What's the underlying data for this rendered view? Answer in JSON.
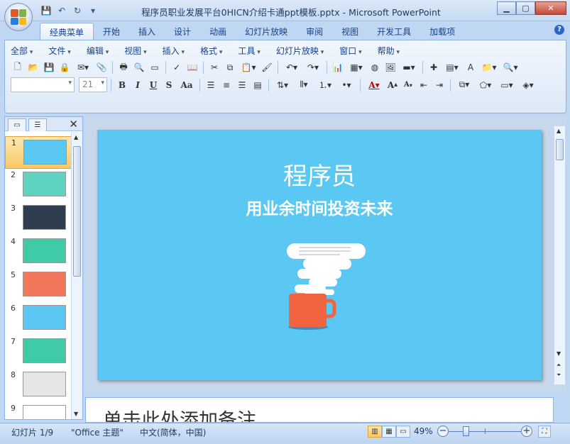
{
  "window": {
    "title": "程序员职业发展平台0HICN介绍卡通ppt模板.pptx - Microsoft PowerPoint",
    "controls": [
      "minimize",
      "maximize",
      "close"
    ]
  },
  "quick_access": [
    {
      "icon": "save-icon"
    },
    {
      "icon": "undo-icon"
    },
    {
      "icon": "redo-icon"
    },
    {
      "icon": "customize-qat-icon"
    }
  ],
  "tabs": [
    {
      "label": "经典菜单",
      "active": true
    },
    {
      "label": "开始"
    },
    {
      "label": "插入"
    },
    {
      "label": "设计"
    },
    {
      "label": "动画"
    },
    {
      "label": "幻灯片放映"
    },
    {
      "label": "审阅"
    },
    {
      "label": "视图"
    },
    {
      "label": "开发工具"
    },
    {
      "label": "加载项"
    }
  ],
  "menubar": [
    "全部",
    "文件",
    "编辑",
    "视图",
    "插入",
    "格式",
    "工具",
    "幻灯片放映",
    "窗口",
    "帮助"
  ],
  "format": {
    "font_name": "",
    "font_size": "21",
    "bold": "B",
    "italic": "I",
    "underline": "U",
    "shadow": "S",
    "case": "Aa",
    "font_color": "A",
    "grow": "A",
    "shrink": "A"
  },
  "slide_panel": {
    "slides": [
      {
        "number": "1",
        "bg": "#5ac8f2",
        "active": true
      },
      {
        "number": "2",
        "bg": "#5dd3c0"
      },
      {
        "number": "3",
        "bg": "#2f3e4e"
      },
      {
        "number": "4",
        "bg": "#3fcaa8"
      },
      {
        "number": "5",
        "bg": "#f2765a"
      },
      {
        "number": "6",
        "bg": "#5ac8f2"
      },
      {
        "number": "7",
        "bg": "#3fcaa8"
      },
      {
        "number": "8",
        "bg": "#e6e6e6"
      },
      {
        "number": "9",
        "bg": "#ffffff"
      }
    ]
  },
  "slide": {
    "title": "程序员",
    "subtitle": "用业余时间投资未来",
    "background": "#5ac8f2",
    "cup_color": "#f2643f"
  },
  "notes": {
    "placeholder": "单击此处添加备注"
  },
  "status": {
    "slide_info": "幻灯片 1/9",
    "theme": "\"Office 主题\"",
    "language": "中文(简体，中国)",
    "zoom": "49%"
  }
}
